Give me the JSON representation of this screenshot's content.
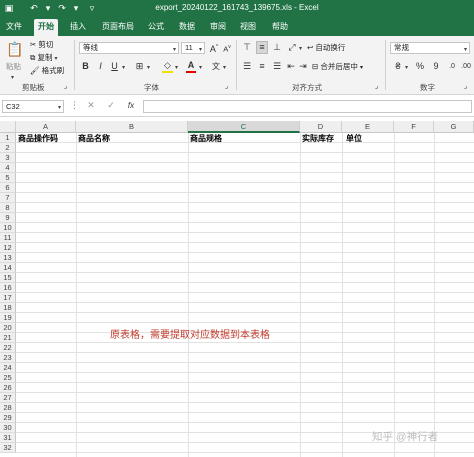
{
  "window": {
    "title": "export_20240122_161743_139675.xls  -  Excel"
  },
  "tabs": [
    "文件",
    "开始",
    "插入",
    "页面布局",
    "公式",
    "数据",
    "审阅",
    "视图",
    "帮助"
  ],
  "ribbon": {
    "clipboard": {
      "paste": "粘贴",
      "cut": "剪切",
      "copy": "复制",
      "format_painter": "格式刷",
      "label": "剪贴板"
    },
    "font": {
      "name": "等线",
      "size": "11",
      "bold": "B",
      "italic": "I",
      "underline": "U",
      "grow": "A",
      "shrink": "A",
      "label": "字体"
    },
    "alignment": {
      "wrap_text": "自动换行",
      "merge_center": "合并后居中",
      "label": "对齐方式"
    },
    "number": {
      "format": "常规",
      "percent": "%",
      "comma": "9",
      "label": "数字"
    }
  },
  "formula_bar": {
    "name_box": "C32",
    "cancel": "✕",
    "enter": "✓",
    "fx": "fx",
    "value": ""
  },
  "columns": [
    "A",
    "B",
    "C",
    "D",
    "E",
    "F",
    "G"
  ],
  "rows": [
    "1",
    "2",
    "3",
    "4",
    "5",
    "6",
    "7",
    "8",
    "9",
    "10",
    "11",
    "12",
    "13",
    "14",
    "15",
    "16",
    "17",
    "18",
    "19",
    "20",
    "21",
    "22",
    "23",
    "24",
    "25",
    "26",
    "27",
    "28",
    "29",
    "30",
    "31",
    "32"
  ],
  "header_row": {
    "a": "商品操作码",
    "b": "商品名称",
    "c": "商品规格",
    "d": "实际库存",
    "e": "单位"
  },
  "annotation": "原表格，需要提取对应数据到本表格",
  "watermark": "知乎 @神行者"
}
